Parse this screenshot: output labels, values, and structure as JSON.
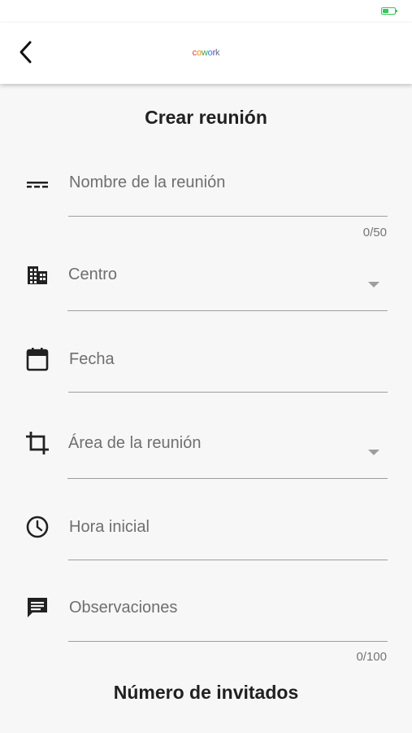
{
  "app": {
    "logo_text": "cowork"
  },
  "header": {
    "back_icon": "chevron-left-icon"
  },
  "form": {
    "title": "Crear reunión",
    "fields": {
      "name": {
        "label": "Nombre de la reunión",
        "icon": "short-text-icon",
        "counter": "0/50"
      },
      "center": {
        "label": "Centro",
        "icon": "building-icon"
      },
      "date": {
        "label": "Fecha",
        "icon": "calendar-icon"
      },
      "area": {
        "label": "Área de la reunión",
        "icon": "crop-icon"
      },
      "start_time": {
        "label": "Hora inicial",
        "icon": "clock-icon"
      },
      "notes": {
        "label": "Observaciones",
        "icon": "comment-icon",
        "counter": "0/100"
      }
    },
    "guests_title": "Número de invitados"
  },
  "colors": {
    "background": "#f7f7f7",
    "appbar": "#ffffff",
    "label": "#6f6f6f",
    "underline": "#9e9e9e",
    "battery": "#35c759"
  }
}
